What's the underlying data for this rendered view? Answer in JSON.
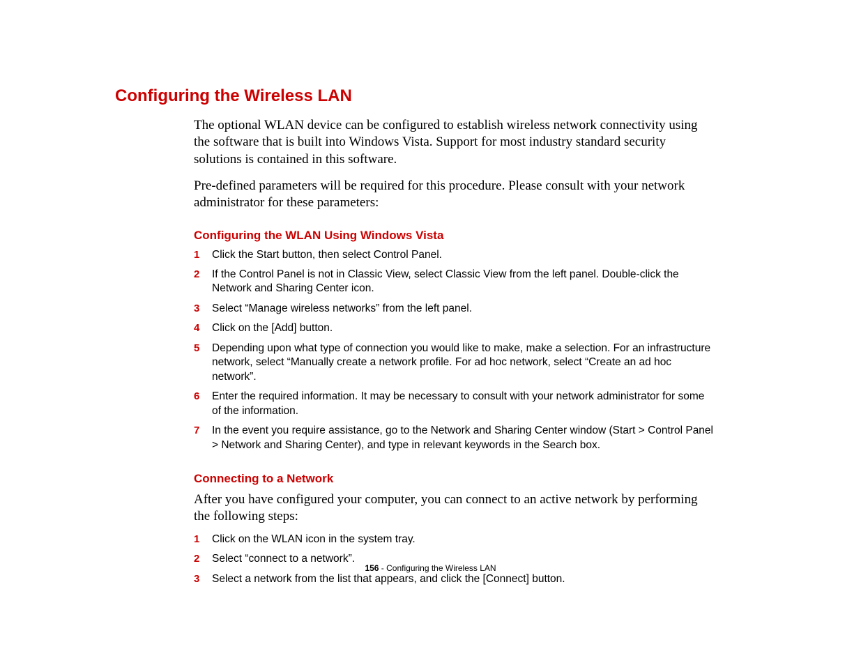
{
  "title": "Configuring the Wireless LAN",
  "intro1": "The optional WLAN device can be configured to establish wireless network connectivity using the software that is built into Windows Vista. Support for most industry standard security solutions is contained in this software.",
  "intro2": "Pre-defined parameters will be required for this procedure. Please consult with your network administrator for these parameters:",
  "section1": {
    "heading": "Configuring the WLAN Using Windows Vista",
    "steps": [
      "Click the Start button, then select Control Panel.",
      "If the Control Panel is not in Classic View, select Classic View from the left panel. Double-click the Network and Sharing Center icon.",
      "Select “Manage wireless networks” from the left panel.",
      "Click on the [Add] button.",
      "Depending upon what type of connection you would like to make, make a selection. For an infrastructure network, select “Manually create a network profile. For ad hoc network, select “Create an ad hoc network”.",
      "Enter the required information. It may be necessary to consult with your network administrator for some of the information.",
      "In the event you require assistance, go to the Network and Sharing Center window (Start > Control Panel > Network and Sharing Center), and type in relevant keywords in the Search box."
    ]
  },
  "section2": {
    "heading": "Connecting to a Network",
    "intro": "After you have configured your computer, you can connect to an active network by performing the following steps:",
    "steps": [
      "Click on the WLAN icon in the system tray.",
      "Select “connect to a network”.",
      "Select a network from the list that appears, and click the [Connect] button."
    ]
  },
  "footer": {
    "page": "156",
    "sep": " - ",
    "label": "Configuring the Wireless LAN"
  }
}
